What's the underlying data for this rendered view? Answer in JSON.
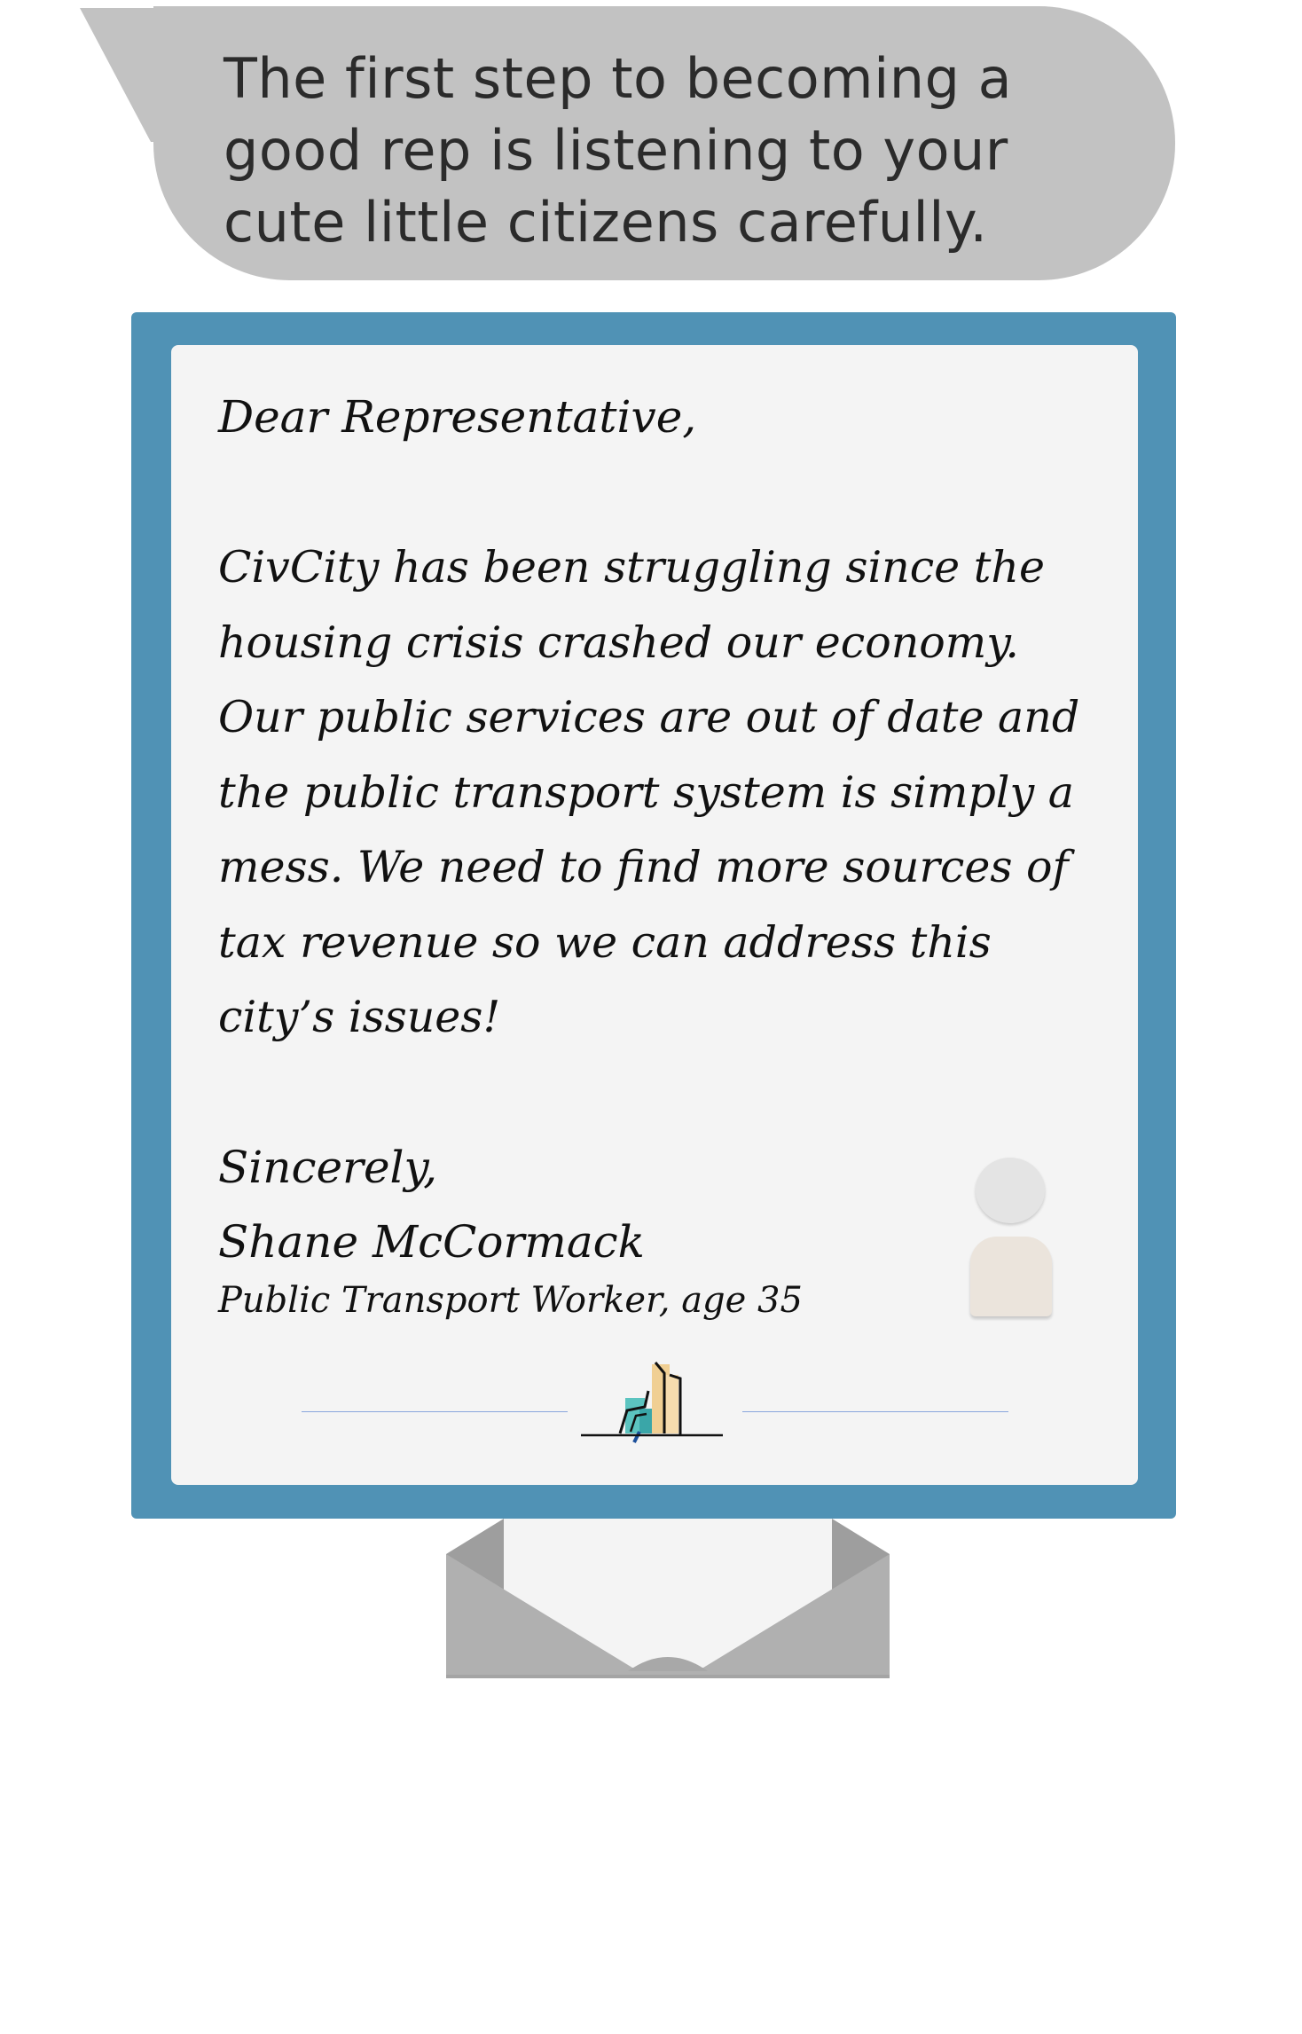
{
  "bubble": {
    "text": "The first step to becoming a good rep is listening to your cute little citizens carefully."
  },
  "letter": {
    "greeting": "Dear Representative,",
    "body": "CivCity has been struggling since the housing crisis crashed our economy. Our public services are out of date and the public transport system is simply a mess. We need to find more sources of tax revenue so we can address this city’s issues!",
    "closing": "Sincerely,",
    "signer_name": "Shane McCormack",
    "signer_role": "Public Transport Worker, age 35"
  },
  "icons": {
    "avatar": "person-icon",
    "logo": "city-skyline-logo",
    "envelope": "open-envelope-icon"
  },
  "colors": {
    "bubble": "#c2c2c2",
    "frame": "#5092b5",
    "paper": "#f4f4f4",
    "envelope": "#b0b0b0"
  }
}
